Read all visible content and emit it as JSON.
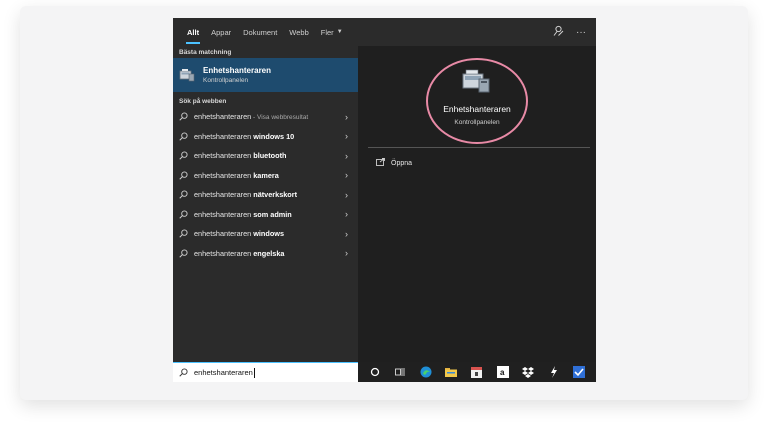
{
  "tabs": [
    {
      "label": "Allt",
      "active": true
    },
    {
      "label": "Appar"
    },
    {
      "label": "Dokument"
    },
    {
      "label": "Webb"
    },
    {
      "label": "Fler"
    }
  ],
  "best_match": {
    "section_label": "Bästa matchning",
    "title": "Enhetshanteraren",
    "subtitle": "Kontrollpanelen"
  },
  "web": {
    "section_label": "Sök på webben",
    "results": [
      {
        "prefix": "enhetshanteraren",
        "bold": "",
        "hint": " - Visa webbresultat"
      },
      {
        "prefix": "enhetshanteraren ",
        "bold": "windows 10",
        "hint": ""
      },
      {
        "prefix": "enhetshanteraren ",
        "bold": "bluetooth",
        "hint": ""
      },
      {
        "prefix": "enhetshanteraren ",
        "bold": "kamera",
        "hint": ""
      },
      {
        "prefix": "enhetshanteraren ",
        "bold": "nätverkskort",
        "hint": ""
      },
      {
        "prefix": "enhetshanteraren ",
        "bold": "som admin",
        "hint": ""
      },
      {
        "prefix": "enhetshanteraren ",
        "bold": "windows",
        "hint": ""
      },
      {
        "prefix": "enhetshanteraren ",
        "bold": "engelska",
        "hint": ""
      }
    ]
  },
  "preview": {
    "title": "Enhetshanteraren",
    "subtitle": "Kontrollpanelen",
    "open_label": "Öppna"
  },
  "search": {
    "value": "enhetshanteraren"
  },
  "colors": {
    "accent": "#4cc2ff",
    "selection": "#1e4b6e",
    "highlight_circle": "#e88aa6"
  },
  "taskbar_icons": [
    "cortana-icon",
    "task-view-icon",
    "edge-icon",
    "file-explorer-icon",
    "calendar-icon",
    "amazon-icon",
    "dropbox-icon",
    "bolt-icon",
    "checkmark-icon"
  ]
}
